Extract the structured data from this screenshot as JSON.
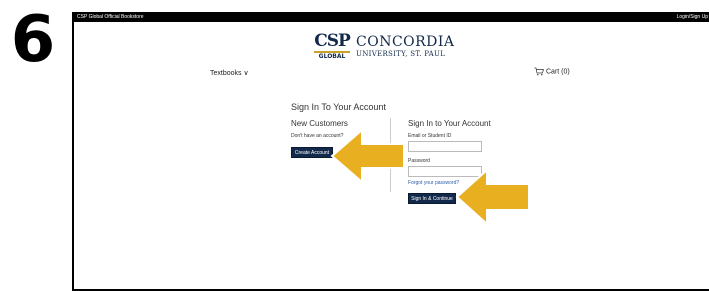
{
  "step": {
    "number": "6"
  },
  "topbar": {
    "brand": "CSP Global Official Bookstore",
    "login": "Login/Sign Up"
  },
  "logo": {
    "csp": "CSP",
    "global": "GLOBAL",
    "concordia": "CONCORDIA",
    "university": "UNIVERSITY, ST. PAUL"
  },
  "nav": {
    "textbooks": "Textbooks ∨",
    "cart": "Cart (0)"
  },
  "signin": {
    "title": "Sign In To Your Account",
    "new_customers": {
      "heading": "New Customers",
      "prompt": "Don't have an account?",
      "create_button": "Create Account"
    },
    "existing": {
      "heading": "Sign In to Your Account",
      "email_label": "Email or Student ID",
      "email_value": "",
      "password_label": "Password",
      "password_value": "",
      "forgot_link": "Forgot your password?",
      "signin_button": "Sign In & Continue"
    }
  },
  "colors": {
    "navy": "#13294b",
    "arrow_yellow": "#e8b020",
    "gold": "#c9a227"
  }
}
